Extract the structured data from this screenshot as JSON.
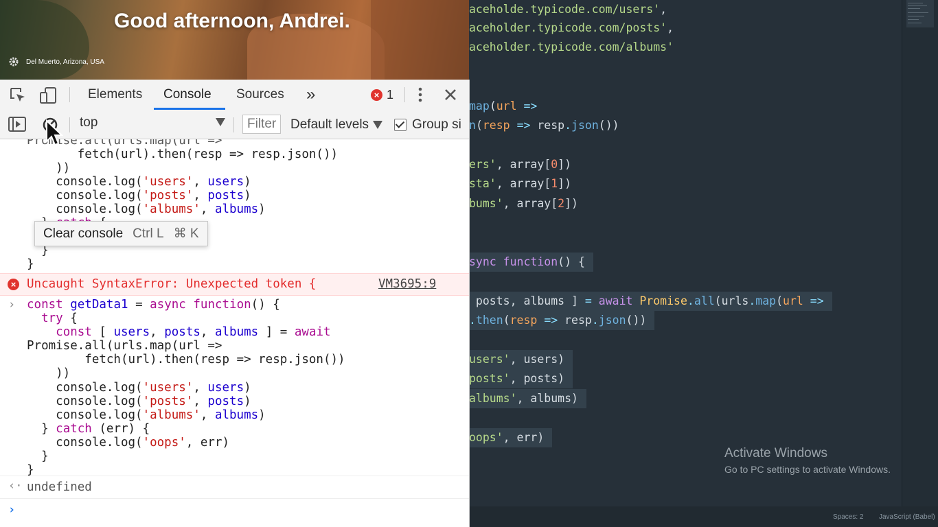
{
  "newtab": {
    "greeting": "Good afternoon, Andrei.",
    "location": "Del Muerto, Arizona, USA"
  },
  "devtools": {
    "tabs": [
      "Elements",
      "Console",
      "Sources"
    ],
    "more_tabs": "»",
    "error_count": "1",
    "toolbar": {
      "context": "top",
      "filter_placeholder": "Filter",
      "levels": "Default levels",
      "group_similar": "Group si"
    },
    "tooltip": {
      "label": "Clear console",
      "shortcut1": "Ctrl L",
      "shortcut2": "⌘ K"
    },
    "error": {
      "message": "Uncaught SyntaxError: Unexpected token {",
      "source": "VM3695:9"
    },
    "result": "undefined"
  },
  "editor": {
    "status": {
      "spaces": "Spaces: 2",
      "language": "JavaScript (Babel)"
    },
    "watermark": {
      "title": "Activate Windows",
      "subtitle": "Go to PC settings to activate Windows."
    }
  },
  "colors": {
    "editor_bg": "#263039",
    "devtools_accent": "#1a73e8",
    "error_red": "#e0342e"
  }
}
